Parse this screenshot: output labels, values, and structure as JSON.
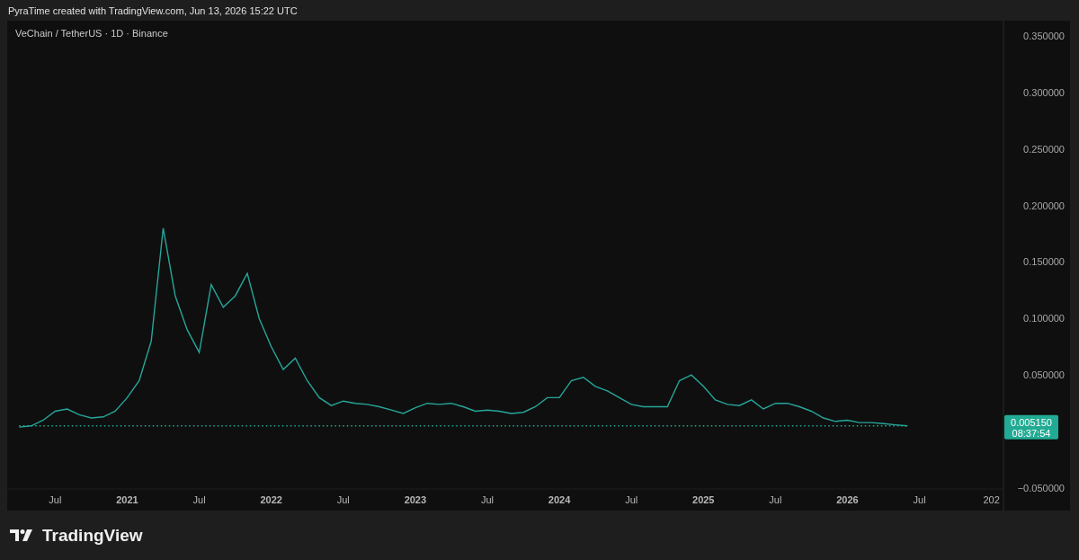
{
  "header": {
    "caption": "PyraTime created with TradingView.com, Jun 13, 2026 15:22 UTC"
  },
  "chart": {
    "symbol": "VeChain / TetherUS · 1D · Binance",
    "last_price": {
      "price": "0.005150",
      "countdown": "08:37:54",
      "color": "#22ab94"
    },
    "chart_data": {
      "type": "line",
      "x": [
        "2020-04",
        "2020-05",
        "2020-06",
        "2020-07",
        "2020-08",
        "2020-09",
        "2020-10",
        "2020-11",
        "2020-12",
        "2021-01",
        "2021-02",
        "2021-03",
        "2021-04",
        "2021-05",
        "2021-06",
        "2021-07",
        "2021-08",
        "2021-09",
        "2021-10",
        "2021-11",
        "2021-12",
        "2022-01",
        "2022-02",
        "2022-03",
        "2022-04",
        "2022-05",
        "2022-06",
        "2022-07",
        "2022-08",
        "2022-09",
        "2022-10",
        "2022-11",
        "2022-12",
        "2023-01",
        "2023-02",
        "2023-03",
        "2023-04",
        "2023-05",
        "2023-06",
        "2023-07",
        "2023-08",
        "2023-09",
        "2023-10",
        "2023-11",
        "2023-12",
        "2024-01",
        "2024-02",
        "2024-03",
        "2024-04",
        "2024-05",
        "2024-06",
        "2024-07",
        "2024-08",
        "2024-09",
        "2024-10",
        "2024-11",
        "2024-12",
        "2025-01",
        "2025-02",
        "2025-03",
        "2025-04",
        "2025-05",
        "2025-06",
        "2025-07",
        "2025-08",
        "2025-09",
        "2025-10",
        "2025-11",
        "2025-12",
        "2026-01",
        "2026-02",
        "2026-03",
        "2026-04",
        "2026-05",
        "2026-06"
      ],
      "series": [
        {
          "color": "#26a69a",
          "values": [
            0.004,
            0.005,
            0.01,
            0.018,
            0.02,
            0.015,
            0.012,
            0.013,
            0.018,
            0.03,
            0.045,
            0.08,
            0.18,
            0.12,
            0.09,
            0.07,
            0.13,
            0.11,
            0.12,
            0.14,
            0.1,
            0.075,
            0.055,
            0.065,
            0.045,
            0.03,
            0.023,
            0.027,
            0.025,
            0.024,
            0.022,
            0.019,
            0.016,
            0.021,
            0.025,
            0.024,
            0.025,
            0.022,
            0.018,
            0.019,
            0.018,
            0.016,
            0.017,
            0.022,
            0.03,
            0.03,
            0.045,
            0.048,
            0.04,
            0.036,
            0.03,
            0.024,
            0.022,
            0.022,
            0.022,
            0.045,
            0.05,
            0.04,
            0.028,
            0.024,
            0.023,
            0.028,
            0.02,
            0.025,
            0.025,
            0.022,
            0.018,
            0.012,
            0.009,
            0.01,
            0.008,
            0.008,
            0.007,
            0.006,
            0.005
          ]
        },
        {
          "color": "#22ab94",
          "line_style": "dotted",
          "values": [
            0.005,
            0.005,
            0.005,
            0.005,
            0.005,
            0.005,
            0.005,
            0.005,
            0.005,
            0.005,
            0.005,
            0.005,
            0.005,
            0.005,
            0.005,
            0.005,
            0.005,
            0.005,
            0.005,
            0.005,
            0.005,
            0.005,
            0.005,
            0.005,
            0.005,
            0.005,
            0.005,
            0.005,
            0.005,
            0.005,
            0.005,
            0.005,
            0.005,
            0.005,
            0.005,
            0.005,
            0.005,
            0.005,
            0.005,
            0.005,
            0.005,
            0.005,
            0.005,
            0.005,
            0.005,
            0.005,
            0.005,
            0.005,
            0.005,
            0.005,
            0.005,
            0.005,
            0.005,
            0.005,
            0.005,
            0.005,
            0.005,
            0.005,
            0.005,
            0.005,
            0.005,
            0.005,
            0.005,
            0.005,
            0.005,
            0.005,
            0.005,
            0.005,
            0.005,
            0.005,
            0.005,
            0.005,
            0.005,
            0.005,
            0.005
          ]
        }
      ],
      "xlim": [
        "2020-03",
        "2027-02"
      ],
      "ylim": [
        -0.05,
        0.3635
      ],
      "yticks": [
        {
          "value": 0.35,
          "label": "0.350000"
        },
        {
          "value": 0.3,
          "label": "0.300000"
        },
        {
          "value": 0.25,
          "label": "0.250000"
        },
        {
          "value": 0.2,
          "label": "0.200000"
        },
        {
          "value": 0.15,
          "label": "0.150000"
        },
        {
          "value": 0.1,
          "label": "0.100000"
        },
        {
          "value": 0.05,
          "label": "0.050000"
        },
        {
          "value": -0.05,
          "label": "−0.050000"
        }
      ],
      "xticks": [
        {
          "value": "2020-07",
          "label": "Jul"
        },
        {
          "value": "2021-01",
          "label": "2021"
        },
        {
          "value": "2021-07",
          "label": "Jul"
        },
        {
          "value": "2022-01",
          "label": "2022"
        },
        {
          "value": "2022-07",
          "label": "Jul"
        },
        {
          "value": "2023-01",
          "label": "2023"
        },
        {
          "value": "2023-07",
          "label": "Jul"
        },
        {
          "value": "2024-01",
          "label": "2024"
        },
        {
          "value": "2024-07",
          "label": "Jul"
        },
        {
          "value": "2025-01",
          "label": "2025"
        },
        {
          "value": "2025-07",
          "label": "Jul"
        },
        {
          "value": "2026-01",
          "label": "2026"
        },
        {
          "value": "2026-07",
          "label": "Jul"
        },
        {
          "value": "2027-01",
          "label": "202"
        }
      ]
    }
  },
  "footer": {
    "logo_text": "TradingView"
  }
}
